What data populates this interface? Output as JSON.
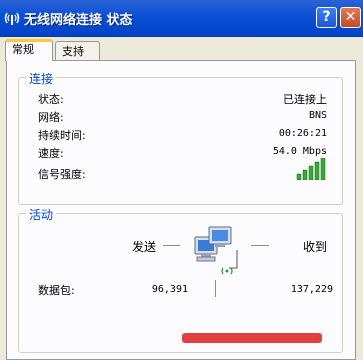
{
  "window": {
    "title": "无线网络连接 状态"
  },
  "titlebar_buttons": {
    "help": "?",
    "close": "✕"
  },
  "tabs": [
    {
      "label": "常规",
      "active": true
    },
    {
      "label": "支持",
      "active": false
    }
  ],
  "connection": {
    "group_title": "连接",
    "rows": [
      {
        "label": "状态:",
        "value": "已连接上"
      },
      {
        "label": "网络:",
        "value": "BNS"
      },
      {
        "label": "持续时间:",
        "value": "00:26:21"
      },
      {
        "label": "速度:",
        "value": "54.0 Mbps"
      },
      {
        "label": "信号强度:",
        "value": ""
      }
    ],
    "signal_bars": 5,
    "signal_color": "#3aa83a"
  },
  "activity": {
    "group_title": "活动",
    "sent_label": "发送",
    "received_label": "收到",
    "packets_label": "数据包:",
    "packets_sent": "96,391",
    "packets_received": "137,229"
  },
  "colors": {
    "titlebar": "#0a4fd6",
    "accent_text": "#0046d5",
    "dialog_bg": "#ece9d8"
  }
}
